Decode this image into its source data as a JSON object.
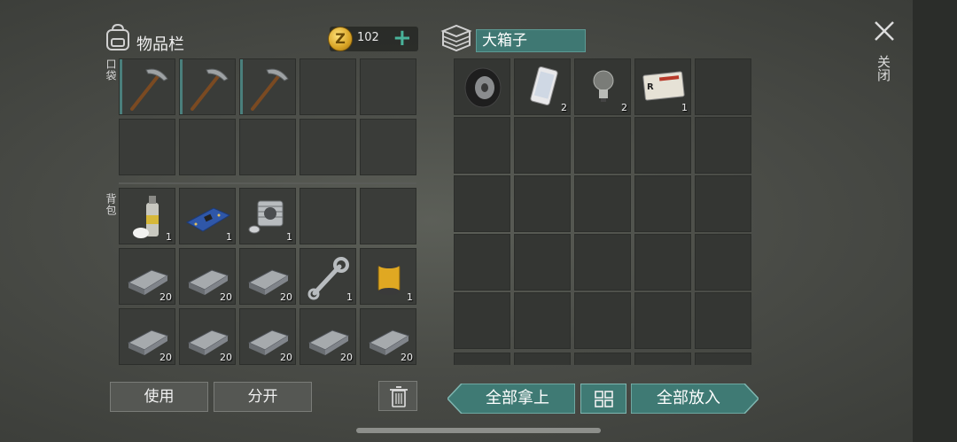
{
  "inventory": {
    "title": "物品栏",
    "currency": {
      "icon": "z-coin-icon",
      "count": "102",
      "add_label": "+"
    },
    "pocket_label": "口袋",
    "backpack_label": "背包",
    "pocket_items": [
      {
        "icon": "pickaxe-icon",
        "qty": ""
      },
      {
        "icon": "pickaxe-icon",
        "qty": ""
      },
      {
        "icon": "pickaxe-icon",
        "qty": ""
      }
    ],
    "backpack_items": [
      {
        "icon": "spray-can-icon",
        "qty": "1"
      },
      {
        "icon": "circuit-board-icon",
        "qty": "1"
      },
      {
        "icon": "engine-cylinder-icon",
        "qty": "1"
      },
      {
        "icon": "iron-ingot-icon",
        "qty": "20"
      },
      {
        "icon": "iron-ingot-icon",
        "qty": "20"
      },
      {
        "icon": "iron-ingot-icon",
        "qty": "20"
      },
      {
        "icon": "wrench-icon",
        "qty": "1"
      },
      {
        "icon": "oil-filter-icon",
        "qty": "1"
      },
      {
        "icon": "iron-ingot-icon",
        "qty": "20"
      },
      {
        "icon": "iron-ingot-icon",
        "qty": "20"
      },
      {
        "icon": "iron-ingot-icon",
        "qty": "20"
      },
      {
        "icon": "iron-ingot-icon",
        "qty": "20"
      },
      {
        "icon": "iron-ingot-icon",
        "qty": "20"
      }
    ],
    "use_label": "使用",
    "split_label": "分开"
  },
  "container": {
    "name": "大箱子",
    "icon": "box-stack-icon",
    "items": [
      {
        "icon": "wheel-icon",
        "qty": ""
      },
      {
        "icon": "smartphone-icon",
        "qty": "2"
      },
      {
        "icon": "light-bulb-icon",
        "qty": "2"
      },
      {
        "icon": "id-card-icon",
        "qty": "1"
      }
    ],
    "take_all_label": "全部拿上",
    "put_all_label": "全部放入"
  },
  "close_label": "关闭",
  "colors": {
    "accent": "#3f7a74",
    "marker": "#4a7f7c",
    "coin": "#d8a324"
  }
}
